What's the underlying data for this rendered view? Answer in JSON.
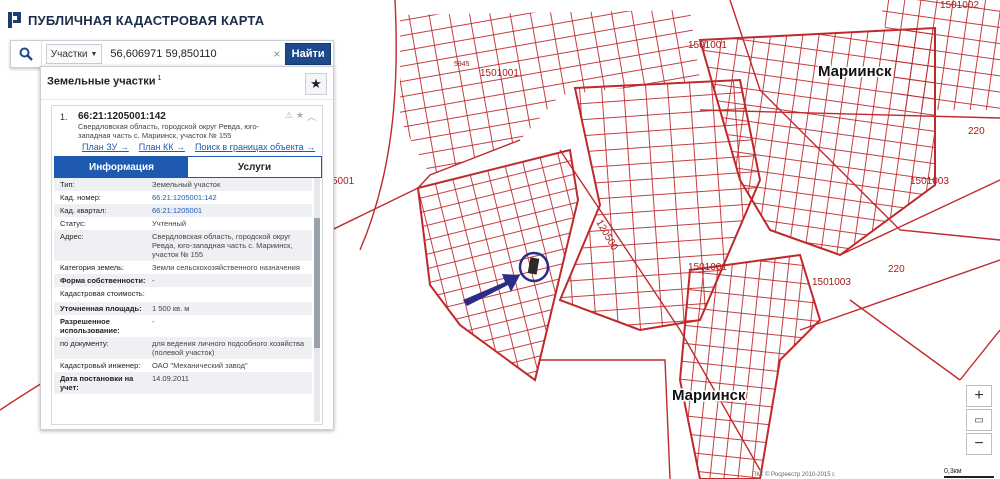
{
  "app": {
    "title": "ПУБЛИЧНАЯ КАДАСТРОВАЯ КАРТА"
  },
  "search": {
    "type_label": "Участки",
    "query": "56,606971 59,850110",
    "button": "Найти",
    "clear": "×"
  },
  "panel": {
    "title": "Земельные участки",
    "count": "1",
    "result": {
      "num": "1.",
      "cad_number": "66:21:1205001:142",
      "address_short": "Свердловская область, городской округ Ревда, юго-западная часть с. Мариинск, участок № 155",
      "links": [
        "План ЗУ →",
        "План КК →",
        "Поиск в границах объекта →"
      ]
    },
    "tabs": {
      "info": "Информация",
      "services": "Услуги"
    },
    "attributes": [
      {
        "k": "Тип:",
        "v": "Земельный участок"
      },
      {
        "k": "Кад. номер:",
        "v": "66:21:1205001:142",
        "link": true
      },
      {
        "k": "Кад. квартал:",
        "v": "66:21:1205001",
        "link": true
      },
      {
        "k": "Статус:",
        "v": "Учтенный"
      },
      {
        "k": "Адрес:",
        "v": "Свердловская область, городской округ Ревда, юго-западная часть с. Мариинск, участок № 155"
      },
      {
        "k": "Категория земель:",
        "v": "Земли сельскохозяйственного назначения"
      },
      {
        "k": "Форма собственности:",
        "v": "-"
      },
      {
        "k": "Кадастровая стоимость:",
        "v": ""
      },
      {
        "k": "Уточненная площадь:",
        "v": "1 500 кв. м"
      },
      {
        "k": "Разрешенное использование:",
        "v": "-"
      },
      {
        "k": "по документу:",
        "v": "для ведения личного подсобного хозяйства (полевой участок)"
      },
      {
        "k": "Кадастровый инженер:",
        "v": "ОАО \"Механический завод\""
      },
      {
        "k": "Дата постановки на учет:",
        "v": "14.09.2011"
      }
    ]
  },
  "map": {
    "towns": [
      "Мариинск",
      "Мариинск"
    ],
    "labels": [
      "1501001",
      "1501001",
      "1501002",
      "1501003",
      "1501003",
      "1501001",
      "220",
      "220",
      "5001",
      "120500",
      "5945"
    ],
    "accent": "#c0292c",
    "marker_color": "#2a2c86"
  },
  "controls": {
    "zoom_in": "+",
    "zoom_out": "−",
    "scale": "0,3км",
    "copyright": "ПКК © Росреестр 2010-2015 г."
  }
}
